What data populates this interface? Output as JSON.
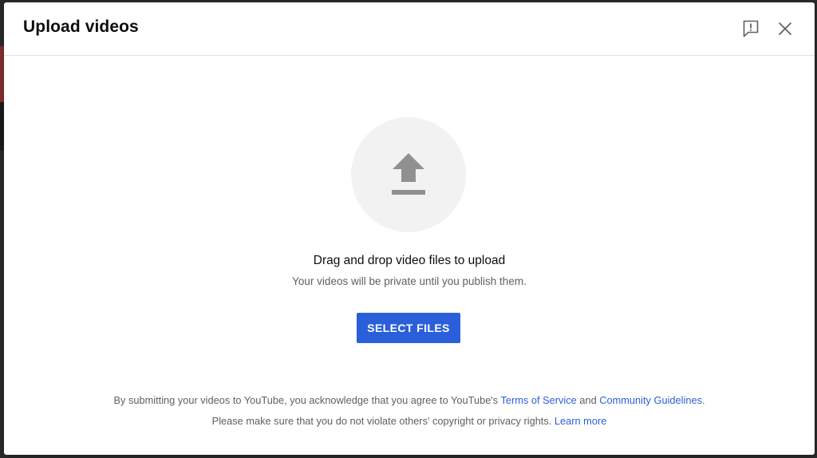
{
  "dialog": {
    "title": "Upload videos",
    "feedback_icon": "feedback-icon",
    "close_icon": "close-icon"
  },
  "upload": {
    "icon": "upload-arrow-icon",
    "primary_text": "Drag and drop video files to upload",
    "secondary_text": "Your videos will be private until you publish them.",
    "button_label": "SELECT FILES"
  },
  "legal": {
    "line1_prefix": "By submitting your videos to YouTube, you acknowledge that you agree to YouTube's ",
    "terms_link": "Terms of Service",
    "line1_mid": " and ",
    "guidelines_link": "Community Guidelines",
    "line1_suffix": ".",
    "line2_prefix": "Please make sure that you do not violate others' copyright or privacy rights. ",
    "learn_more_link": "Learn more"
  },
  "colors": {
    "accent": "#2b5fd9",
    "icon_gray": "#909090",
    "circle_bg": "#f2f2f2"
  }
}
